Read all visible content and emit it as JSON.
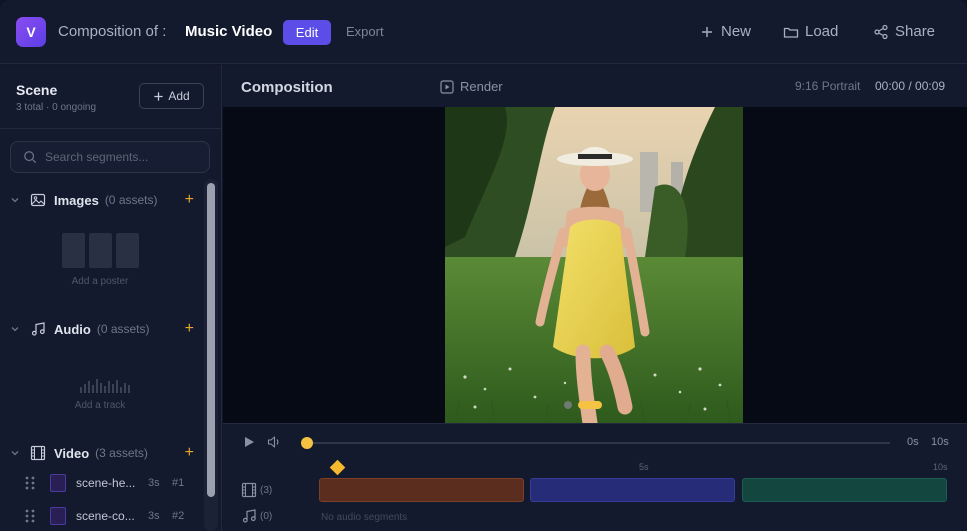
{
  "header": {
    "logo_letter": "V",
    "composition_prefix": "Composition of :",
    "composition_name": "Music Video",
    "edit_label": "Edit",
    "export_label": "Export",
    "new_label": "New",
    "load_label": "Load",
    "share_label": "Share",
    "accent_color": "#5b4ee8"
  },
  "sidebar": {
    "title": "Scene",
    "subtitle": "3 total · 0 ongoing",
    "add_label": "Add",
    "search_placeholder": "Search segments...",
    "images": {
      "name": "Images",
      "count": "(0 assets)",
      "placeholder": "Add a poster",
      "icon": "image-icon"
    },
    "audio": {
      "name": "Audio",
      "count": "(0 assets)",
      "placeholder": "Add a track",
      "icon": "music-note-icon"
    },
    "video": {
      "name": "Video",
      "count": "(3 assets)",
      "icon": "film-icon",
      "items": [
        {
          "name": "scene-he...",
          "duration": "3s",
          "index": "#1"
        },
        {
          "name": "scene-co...",
          "duration": "3s",
          "index": "#2"
        }
      ]
    },
    "plus_color": "#e7a62b"
  },
  "main": {
    "title": "Composition",
    "render_label": "Render",
    "format": "9:16 Portrait",
    "time": "00:00 / 00:09",
    "carousel": {
      "count": 2,
      "active": 1
    },
    "transport": {
      "start": "0s",
      "end": "10s",
      "progress": 0
    },
    "timeline": {
      "tick_mid": "5s",
      "tick_end": "10s",
      "video_count": "(3)",
      "audio_count": "(0)",
      "no_audio_text": "No audio segments",
      "segment_colors": [
        "#5a2d1f",
        "#272c78",
        "#12463e"
      ]
    },
    "highlight_color": "#f5c242"
  }
}
